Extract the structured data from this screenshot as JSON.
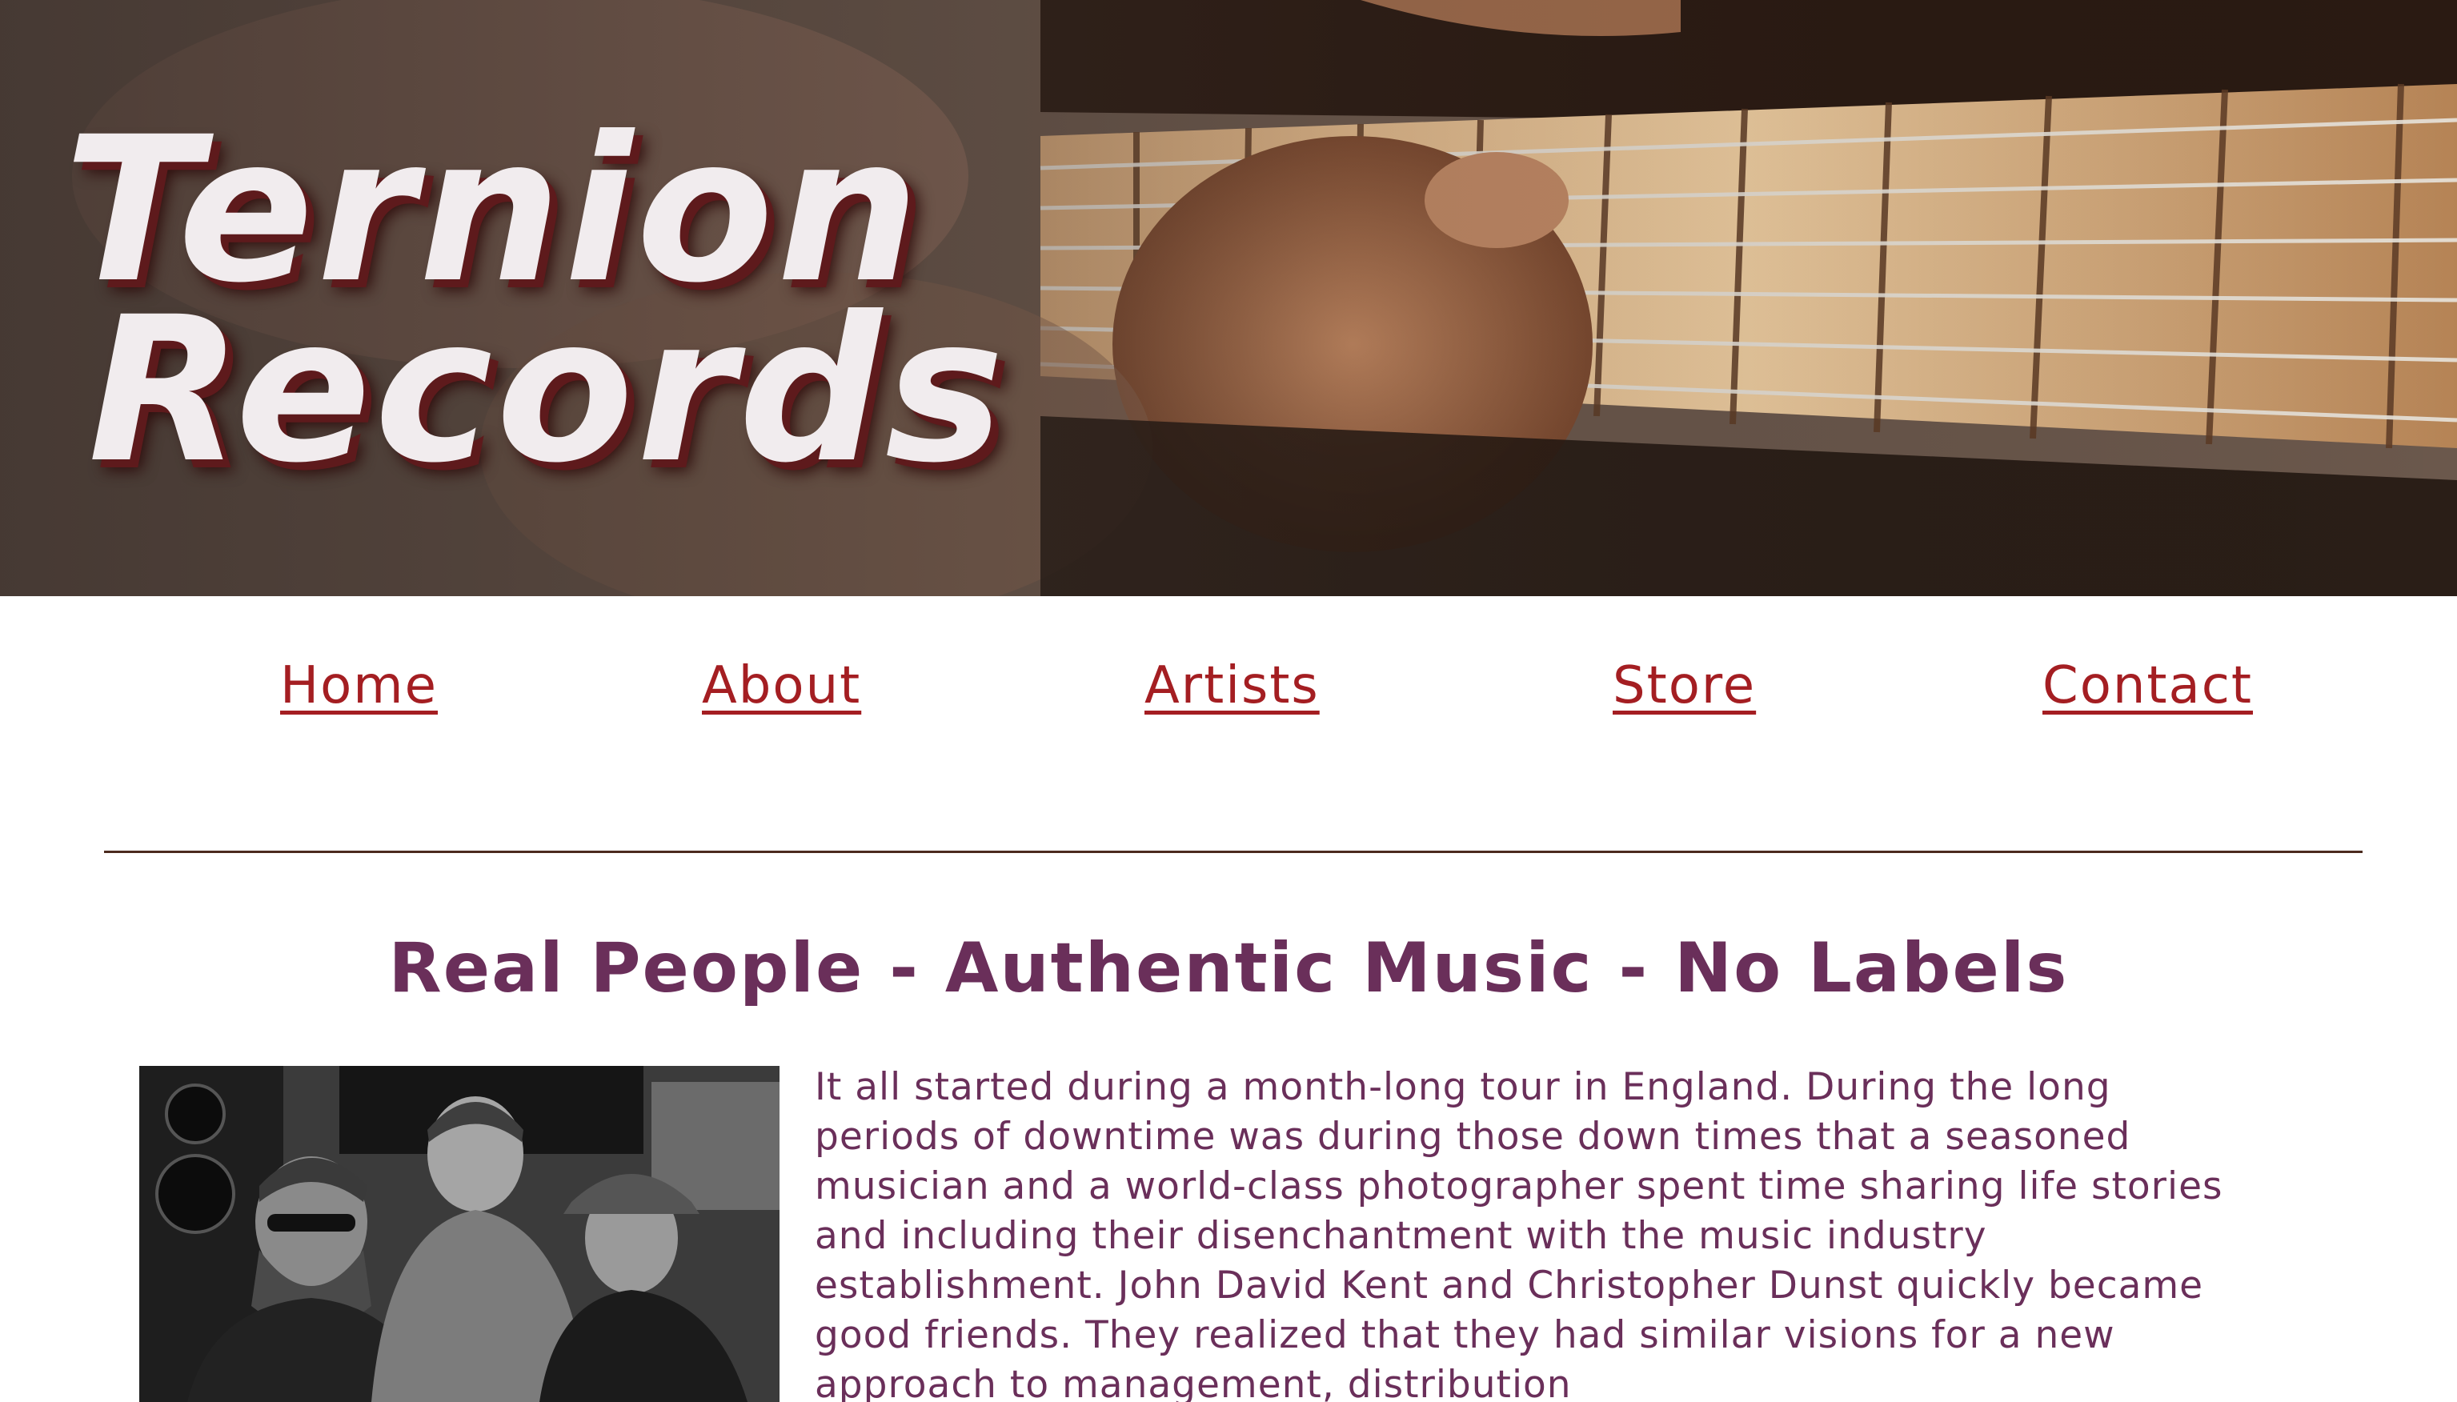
{
  "site": {
    "brand_line1": "Ternion",
    "brand_line2": "Records"
  },
  "nav": {
    "items": [
      {
        "label": "Home"
      },
      {
        "label": "About"
      },
      {
        "label": "Artists"
      },
      {
        "label": "Store"
      },
      {
        "label": "Contact"
      }
    ]
  },
  "main": {
    "heading": "Real People - Authentic Music - No Labels",
    "paragraph": "It all started during a month-long tour in England. During the long periods of downtime was during those down times that a seasoned musician and a world-class photographer spent time sharing life stories and including their disenchantment with the music industry establishment. John David Kent and Christopher Dunst quickly became good friends. They realized that they had similar visions for a new approach to management, distribution"
  },
  "colors": {
    "nav_link": "#a41e22",
    "heading": "#6a2f5a",
    "body_text": "#6a2f5a",
    "divider": "#4b2a1e",
    "hero_text": "#f1ecee",
    "hero_shadow": "#5e1a1c"
  },
  "images": {
    "hero": "guitar-fretboard-photo",
    "photo": "three-men-studio-photo"
  }
}
